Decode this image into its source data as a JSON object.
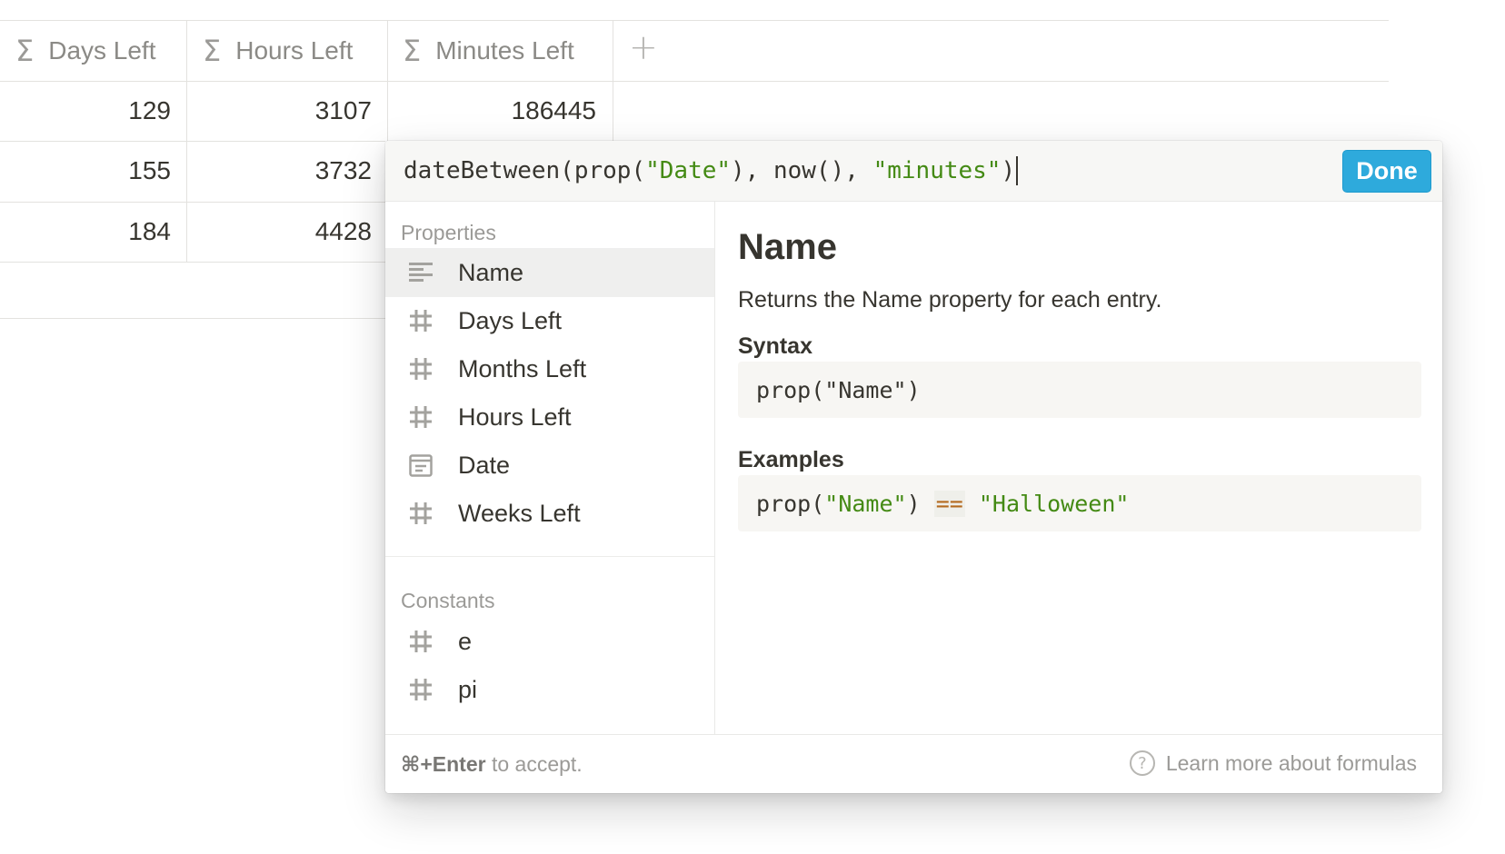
{
  "table": {
    "columns": [
      {
        "label": "Days Left",
        "icon": "sigma-icon"
      },
      {
        "label": "Hours Left",
        "icon": "sigma-icon"
      },
      {
        "label": "Minutes Left",
        "icon": "sigma-icon"
      }
    ],
    "add_column_glyph": "+",
    "rows": [
      {
        "days": "129",
        "hours": "3107",
        "minutes": "186445"
      },
      {
        "days": "155",
        "hours": "3732",
        "minutes": ""
      },
      {
        "days": "184",
        "hours": "4428",
        "minutes": ""
      }
    ]
  },
  "formula_popup": {
    "formula_parts": {
      "p1": "dateBetween(prop(",
      "s1": "\"Date\"",
      "p2": "), now(), ",
      "s2": "\"minutes\"",
      "p3": ")"
    },
    "done_label": "Done",
    "properties_heading": "Properties",
    "properties": [
      {
        "label": "Name",
        "icon": "text-lines-icon",
        "selected": true
      },
      {
        "label": "Days Left",
        "icon": "hash-icon"
      },
      {
        "label": "Months Left",
        "icon": "hash-icon"
      },
      {
        "label": "Hours Left",
        "icon": "hash-icon"
      },
      {
        "label": "Date",
        "icon": "calendar-icon"
      },
      {
        "label": "Weeks Left",
        "icon": "hash-icon"
      }
    ],
    "constants_heading": "Constants",
    "constants": [
      {
        "label": "e",
        "icon": "hash-icon"
      },
      {
        "label": "pi",
        "icon": "hash-icon"
      }
    ],
    "doc": {
      "title": "Name",
      "description": "Returns the Name property for each entry.",
      "syntax_heading": "Syntax",
      "syntax_parts": {
        "a": "prop(",
        "b": "\"Name\"",
        "c": ")"
      },
      "examples_heading": "Examples",
      "example_parts": {
        "a": "prop(",
        "b": "\"Name\"",
        "c": ") ",
        "op": "==",
        "d": " ",
        "e": "\"Halloween\""
      }
    },
    "footer": {
      "shortcut": "⌘+Enter",
      "hint_suffix": " to accept.",
      "learn_more": "Learn more about formulas",
      "help_glyph": "?"
    }
  },
  "colors": {
    "accent": "#2eaadc",
    "string": "#448a14",
    "operator": "#b46a1f",
    "text": "#37352f",
    "muted": "#9b9a97"
  }
}
